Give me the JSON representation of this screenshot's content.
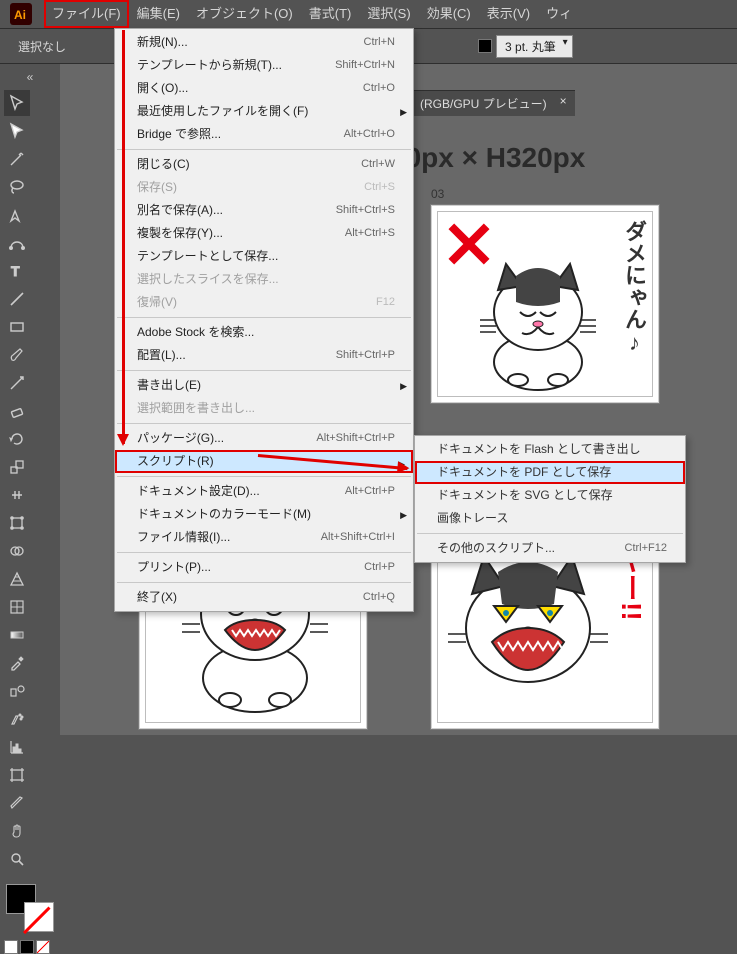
{
  "menubar": {
    "items": [
      "ファイル(F)",
      "編集(E)",
      "オブジェクト(O)",
      "書式(T)",
      "選択(S)",
      "効果(C)",
      "表示(V)",
      "ウィ"
    ]
  },
  "optionsbar": {
    "no_selection": "選択なし",
    "stroke_combo": "3 pt. 丸筆"
  },
  "doc_tab": {
    "label": "(RGB/GPU プレビュー)",
    "close": "×"
  },
  "dims": "70px × H320px",
  "artboards": {
    "top_right": {
      "label": "03",
      "caption": "ダメにゃん♪"
    },
    "bottom_left": {
      "caption": ""
    },
    "bottom_right": {
      "caption": "ヤー!!"
    }
  },
  "file_menu": {
    "items": [
      {
        "label": "新規(N)...",
        "shortcut": "Ctrl+N"
      },
      {
        "label": "テンプレートから新規(T)...",
        "shortcut": "Shift+Ctrl+N"
      },
      {
        "label": "開く(O)...",
        "shortcut": "Ctrl+O"
      },
      {
        "label": "最近使用したファイルを開く(F)",
        "sub": true
      },
      {
        "label": "Bridge で参照...",
        "shortcut": "Alt+Ctrl+O"
      },
      {
        "sep": true
      },
      {
        "label": "閉じる(C)",
        "shortcut": "Ctrl+W"
      },
      {
        "label": "保存(S)",
        "shortcut": "Ctrl+S",
        "disabled": true
      },
      {
        "label": "別名で保存(A)...",
        "shortcut": "Shift+Ctrl+S"
      },
      {
        "label": "複製を保存(Y)...",
        "shortcut": "Alt+Ctrl+S"
      },
      {
        "label": "テンプレートとして保存..."
      },
      {
        "label": "選択したスライスを保存...",
        "disabled": true
      },
      {
        "label": "復帰(V)",
        "shortcut": "F12",
        "disabled": true
      },
      {
        "sep": true
      },
      {
        "label": "Adobe Stock を検索..."
      },
      {
        "label": "配置(L)...",
        "shortcut": "Shift+Ctrl+P"
      },
      {
        "sep": true
      },
      {
        "label": "書き出し(E)",
        "sub": true
      },
      {
        "label": "選択範囲を書き出し...",
        "disabled": true
      },
      {
        "sep": true
      },
      {
        "label": "パッケージ(G)...",
        "shortcut": "Alt+Shift+Ctrl+P"
      },
      {
        "label": "スクリプト(R)",
        "sub": true,
        "highlight": true,
        "boxed": true
      },
      {
        "sep": true
      },
      {
        "label": "ドキュメント設定(D)...",
        "shortcut": "Alt+Ctrl+P"
      },
      {
        "label": "ドキュメントのカラーモード(M)",
        "sub": true
      },
      {
        "label": "ファイル情報(I)...",
        "shortcut": "Alt+Shift+Ctrl+I"
      },
      {
        "sep": true
      },
      {
        "label": "プリント(P)...",
        "shortcut": "Ctrl+P"
      },
      {
        "sep": true
      },
      {
        "label": "終了(X)",
        "shortcut": "Ctrl+Q"
      }
    ]
  },
  "script_submenu": {
    "items": [
      {
        "label": "ドキュメントを Flash として書き出し"
      },
      {
        "label": "ドキュメントを PDF として保存",
        "highlight": true,
        "boxed": true
      },
      {
        "label": "ドキュメントを SVG として保存"
      },
      {
        "label": "画像トレース"
      },
      {
        "sep": true
      },
      {
        "label": "その他のスクリプト...",
        "shortcut": "Ctrl+F12"
      }
    ]
  }
}
